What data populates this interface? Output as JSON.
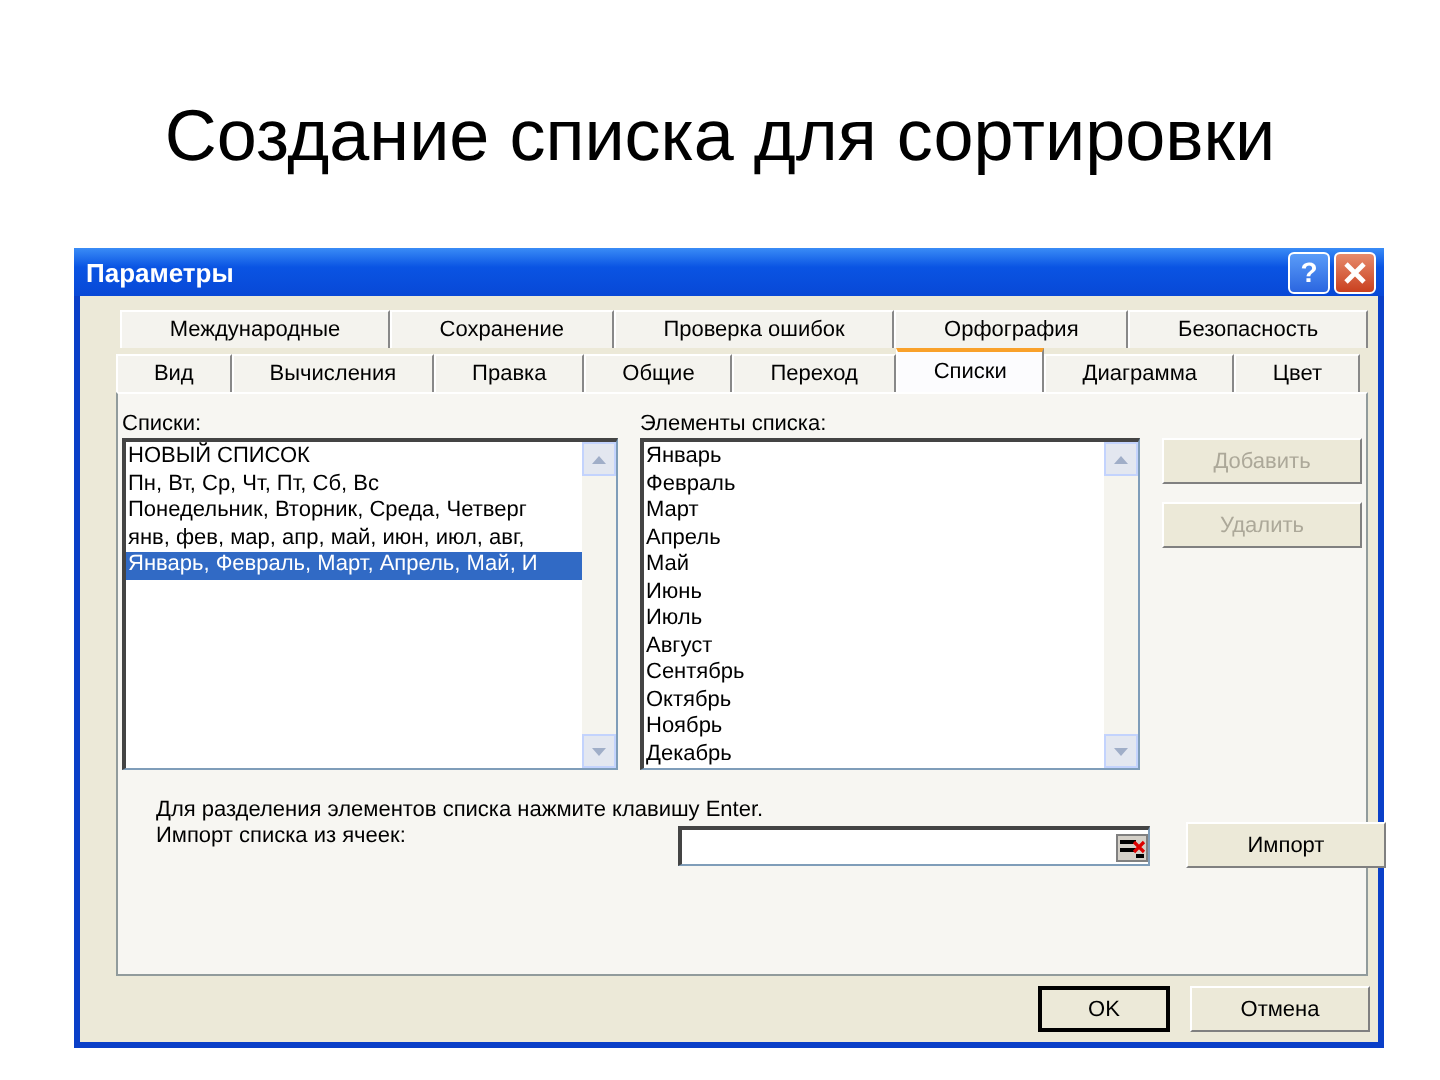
{
  "slide": {
    "title": "Создание списка для сортировки"
  },
  "window": {
    "title": "Параметры",
    "help": "?"
  },
  "tab_rows": [
    [
      {
        "label": "Международные",
        "selected": false
      },
      {
        "label": "Сохранение",
        "selected": false
      },
      {
        "label": "Проверка ошибок",
        "selected": false
      },
      {
        "label": "Орфография",
        "selected": false
      },
      {
        "label": "Безопасность",
        "selected": false
      }
    ],
    [
      {
        "label": "Вид",
        "selected": false
      },
      {
        "label": "Вычисления",
        "selected": false
      },
      {
        "label": "Правка",
        "selected": false
      },
      {
        "label": "Общие",
        "selected": false
      },
      {
        "label": "Переход",
        "selected": false
      },
      {
        "label": "Списки",
        "selected": true
      },
      {
        "label": "Диаграмма",
        "selected": false
      },
      {
        "label": "Цвет",
        "selected": false
      }
    ]
  ],
  "lists": {
    "label": "Списки:",
    "items": [
      {
        "text": "НОВЫЙ СПИСОК",
        "selected": false
      },
      {
        "text": "Пн, Вт, Ср, Чт, Пт, Сб, Вс",
        "selected": false
      },
      {
        "text": "Понедельник, Вторник, Среда, Четверг",
        "selected": false
      },
      {
        "text": "янв, фев, мар, апр, май, июн, июл, авг,",
        "selected": false
      },
      {
        "text": "Январь, Февраль, Март, Апрель, Май, И",
        "selected": true
      }
    ]
  },
  "elements": {
    "label": "Элементы списка:",
    "items": [
      "Январь",
      "Февраль",
      "Март",
      "Апрель",
      "Май",
      "Июнь",
      "Июль",
      "Август",
      "Сентябрь",
      "Октябрь",
      "Ноябрь",
      "Декабрь"
    ]
  },
  "side_buttons": [
    {
      "label": "Добавить",
      "disabled": true
    },
    {
      "label": "Удалить",
      "disabled": true
    }
  ],
  "hint": "Для разделения элементов списка нажмите клавишу Enter.",
  "import": {
    "label": "Импорт списка из ячеек:",
    "button": "Импорт"
  },
  "footer_buttons": [
    {
      "label": "OK",
      "default": true
    },
    {
      "label": "Отмена",
      "default": false
    }
  ]
}
